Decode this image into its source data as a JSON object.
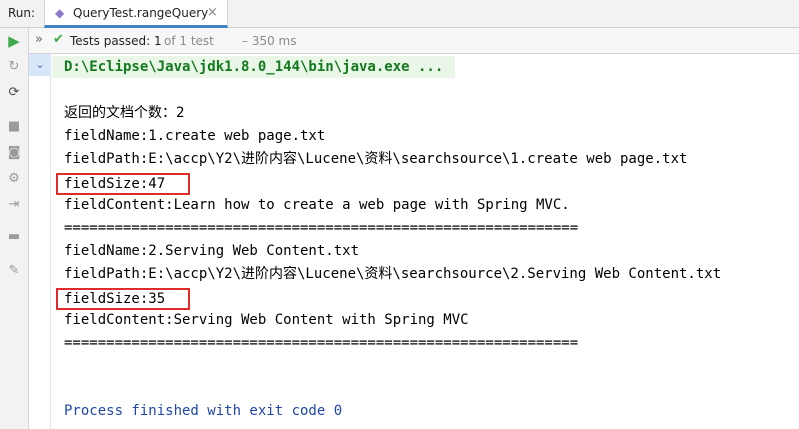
{
  "run_panel": {
    "label": "Run:",
    "tab": {
      "title": "QueryTest.rangeQuery",
      "close": "×"
    }
  },
  "status": {
    "passed_prefix": "Tests passed:",
    "passed_count": "1",
    "of_total": "of 1 test",
    "duration": "– 350 ms"
  },
  "console": {
    "command": "D:\\Eclipse\\Java\\jdk1.8.0_144\\bin\\java.exe ...",
    "lines": [
      "返回的文档个数：2",
      "fieldName:1.create web page.txt",
      "fieldPath:E:\\accp\\Y2\\进阶内容\\Lucene\\资料\\searchsource\\1.create web page.txt",
      "fieldSize:47",
      "fieldContent:Learn how to create a web page with Spring MVC.",
      "=============================================================",
      "fieldName:2.Serving Web Content.txt",
      "fieldPath:E:\\accp\\Y2\\进阶内容\\Lucene\\资料\\searchsource\\2.Serving Web Content.txt",
      "fieldSize:35",
      "fieldContent:Serving Web Content with Spring MVC",
      "============================================================="
    ],
    "finish": "Process finished with exit code 0"
  },
  "icons": {
    "tab": "junit-run-icon",
    "toolbar": [
      "rerun-icon",
      "rerun-failed-icon",
      "toggle-auto-test-icon",
      "stop-icon",
      "screenshot-icon",
      "settings-icon",
      "exit-icon",
      "layout-icon",
      "pin-icon"
    ]
  },
  "colors": {
    "command_text": "#127a1d",
    "command_bg": "#eaf6e8",
    "highlight_border": "#e12b2b",
    "finish_text": "#1f46a8",
    "pass_check": "#3ea84a"
  }
}
